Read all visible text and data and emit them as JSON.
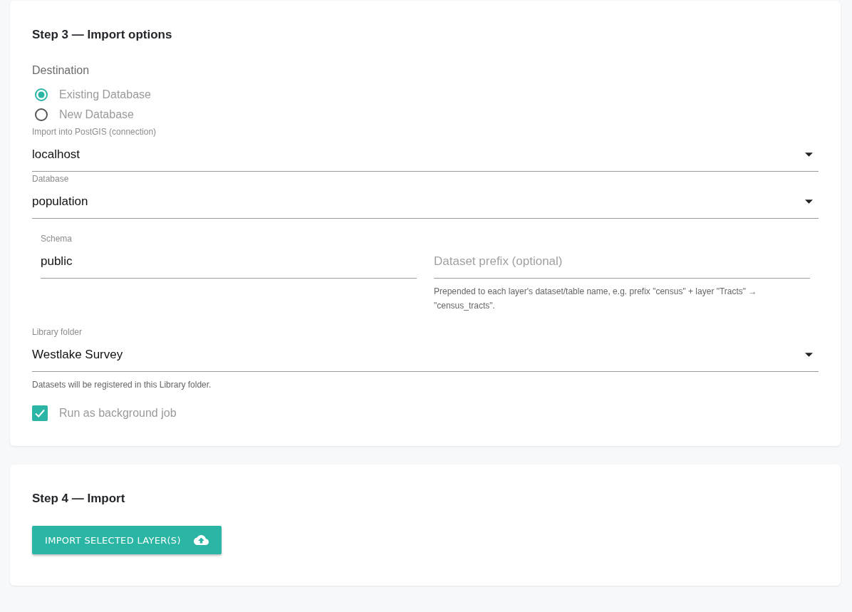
{
  "step3": {
    "title": "Step 3 — Import options",
    "destination": {
      "label": "Destination",
      "options": [
        {
          "label": "Existing Database",
          "selected": true
        },
        {
          "label": "New Database",
          "selected": false
        }
      ]
    },
    "connection": {
      "label": "Import into PostGIS (connection)",
      "value": "localhost"
    },
    "database": {
      "label": "Database",
      "value": "population"
    },
    "schema": {
      "label": "Schema",
      "value": "public"
    },
    "dataset_prefix": {
      "placeholder": "Dataset prefix (optional)",
      "helper": "Prepended to each layer's dataset/table name, e.g. prefix \"census\" + layer \"Tracts\" → \"census_tracts\"."
    },
    "library_folder": {
      "label": "Library folder",
      "value": "Westlake Survey",
      "helper": "Datasets will be registered in this Library folder."
    },
    "background_job": {
      "label": "Run as background job",
      "checked": true
    }
  },
  "step4": {
    "title": "Step 4 — Import",
    "button": {
      "label": "IMPORT SELECTED LAYER(S)"
    }
  }
}
